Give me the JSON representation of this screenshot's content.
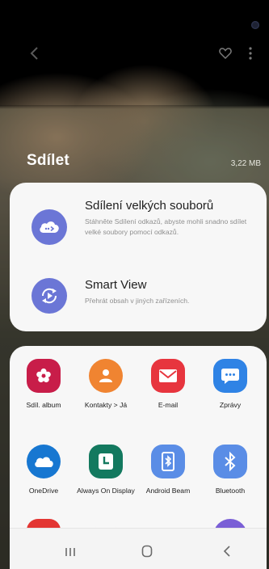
{
  "header": {
    "title": "Sdílet",
    "file_size": "3,22 MB"
  },
  "featured": [
    {
      "title": "Sdílení velkých souborů",
      "description": "Stáhněte Sdílení odkazů, abyste mohli snadno sdílet velké soubory pomocí odkazů.",
      "icon": "cloud-share-icon",
      "color": "#6b76d6"
    },
    {
      "title": "Smart View",
      "description": "Přehrát obsah v jiných zařízeních.",
      "icon": "smart-view-icon",
      "color": "#6b76d6"
    }
  ],
  "apps": [
    {
      "label": "Sdíl. album",
      "icon": "flower-icon",
      "color": "#c81d49"
    },
    {
      "label": "Kontakty > Já",
      "icon": "contact-person-icon",
      "color": "#f08431"
    },
    {
      "label": "E-mail",
      "icon": "envelope-icon",
      "color": "#e7353e"
    },
    {
      "label": "Zprávy",
      "icon": "chat-bubble-icon",
      "color": "#2f83e5"
    },
    {
      "label": "OneDrive",
      "icon": "cloud-icon",
      "color": "#1777d1"
    },
    {
      "label": "Always On Display",
      "icon": "clock-icon",
      "color": "#13795f"
    },
    {
      "label": "Android Beam",
      "icon": "beam-icon",
      "color": "#5a8de6"
    },
    {
      "label": "Bluetooth",
      "icon": "bluetooth-icon",
      "color": "#5a8de6"
    }
  ],
  "partial_apps": [
    {
      "icon": "app-icon-partial",
      "color": "#e33633"
    },
    {
      "icon": "gmail-icon-partial",
      "color": "#d93025"
    },
    {
      "icon": "app-icon-partial",
      "color": "#f29b1d"
    },
    {
      "icon": "app-icon-partial",
      "color": "#7a5fd6"
    }
  ]
}
